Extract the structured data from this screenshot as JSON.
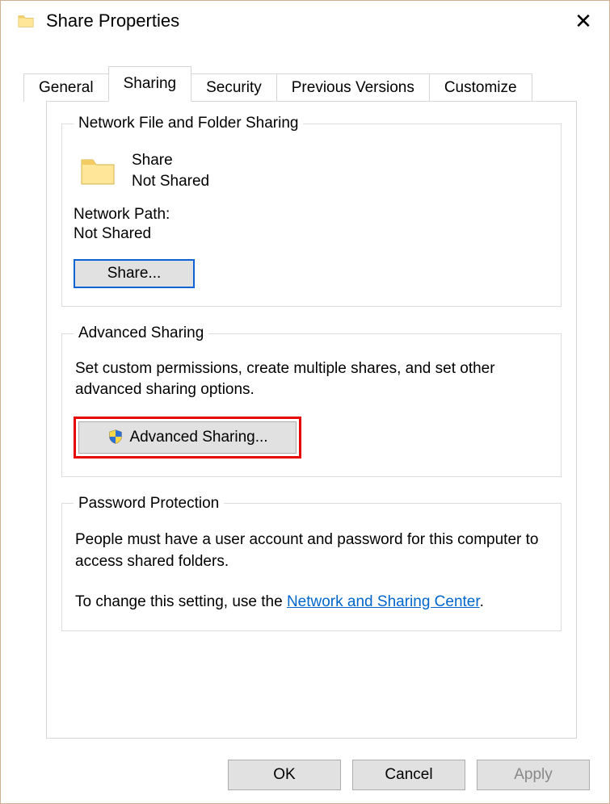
{
  "window": {
    "title": "Share Properties"
  },
  "tabs": {
    "general": "General",
    "sharing": "Sharing",
    "security": "Security",
    "previous": "Previous Versions",
    "customize": "Customize"
  },
  "network_sharing": {
    "legend": "Network File and Folder Sharing",
    "share_name": "Share",
    "share_status": "Not Shared",
    "path_label": "Network Path:",
    "path_value": "Not Shared",
    "share_button": "Share..."
  },
  "advanced_sharing": {
    "legend": "Advanced Sharing",
    "description": "Set custom permissions, create multiple shares, and set other advanced sharing options.",
    "button": "Advanced Sharing..."
  },
  "password_protection": {
    "legend": "Password Protection",
    "line1": "People must have a user account and password for this computer to access shared folders.",
    "line2_prefix": "To change this setting, use the ",
    "link_text": "Network and Sharing Center",
    "line2_suffix": "."
  },
  "buttons": {
    "ok": "OK",
    "cancel": "Cancel",
    "apply": "Apply"
  }
}
